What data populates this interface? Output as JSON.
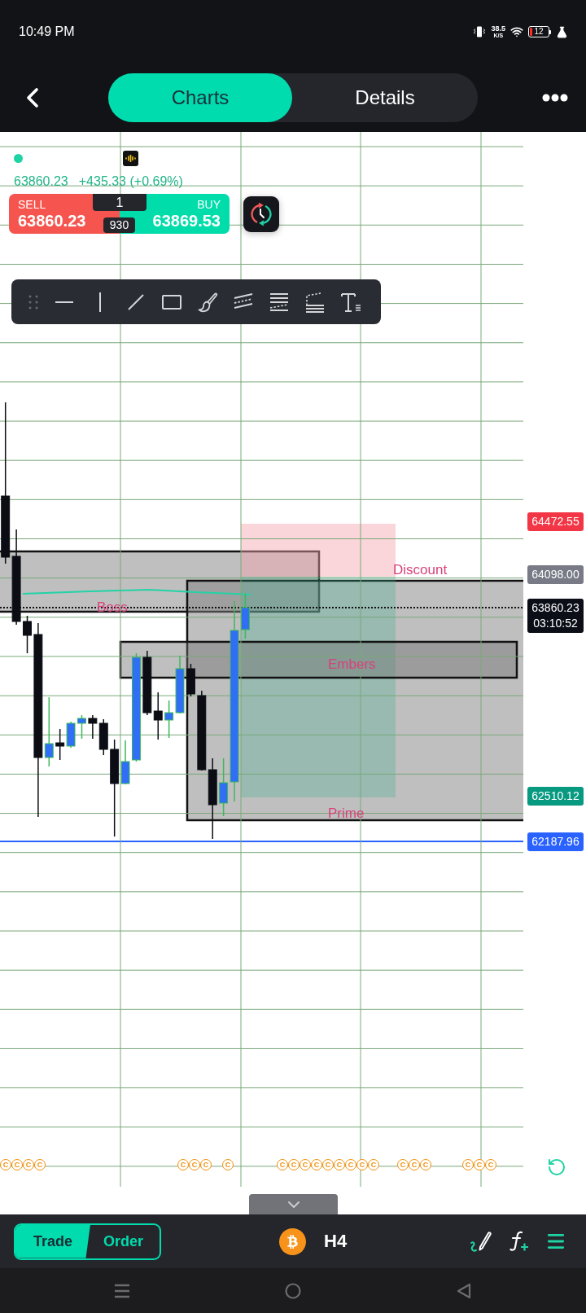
{
  "status_bar": {
    "time": "10:49 PM",
    "net_speed": "38.5",
    "net_speed_unit": "K/S",
    "battery": "12"
  },
  "header": {
    "tabs": [
      {
        "label": "Charts",
        "selected": true
      },
      {
        "label": "Details",
        "selected": false
      }
    ]
  },
  "quote": {
    "price": "63860.23",
    "change": "+435.33 (+0.69%)"
  },
  "trade_panel": {
    "sell": {
      "label": "SELL",
      "price": "63860.23"
    },
    "buy": {
      "label": "BUY",
      "price": "63869.53"
    },
    "lot_size": "1",
    "spread": "930"
  },
  "chart": {
    "chart_data": {
      "type": "candlestick",
      "categories": [
        null,
        null,
        null,
        null,
        null,
        null,
        null,
        null,
        null,
        null,
        null,
        null,
        null,
        null,
        null,
        null,
        null,
        null,
        null,
        null,
        null,
        null,
        null,
        null,
        null,
        null,
        null,
        null,
        null,
        null,
        null,
        null,
        null,
        null,
        null,
        null,
        null,
        null,
        null,
        null,
        null,
        null,
        null,
        null,
        null,
        null,
        null,
        null
      ],
      "ylim": [
        59717.1,
        67264
      ],
      "yticks": [
        {
          "value": 64472.55,
          "label": "64472.55"
        },
        {
          "value": 64098.0,
          "label": "64098.00"
        },
        {
          "value": 63860.23,
          "label": "63860.23"
        },
        {
          "value": 62510.12,
          "label": "62510.12"
        },
        {
          "value": 62187.96,
          "label": "62187.96"
        }
      ],
      "ohlc": [
        [
          64659.0,
          65329.2,
          64175.3,
          64221.9
        ],
        [
          64227.8,
          64420.1,
          63738.2,
          63761.6
        ],
        [
          63761.6,
          63802.4,
          63534.3,
          63662.5
        ],
        [
          63668.3,
          63749.9,
          62362.9,
          62788.3
        ],
        [
          62788.3,
          63219.6,
          62724.2,
          62887.4
        ],
        [
          62893.2,
          62992.3,
          62770.9,
          62869.9
        ],
        [
          62869.9,
          63044.8,
          62858.3,
          63033.1
        ],
        [
          63033.1,
          63091.4,
          62922.4,
          63068.1
        ],
        [
          63068.1,
          63091.4,
          62922.4,
          63033.1
        ],
        [
          63033.1,
          63062.2,
          62805.8,
          62846.6
        ],
        [
          62846.6,
          62916.5,
          62223.0,
          62601.8
        ],
        [
          62601.8,
          62910.7,
          62596.0,
          62759.2
        ],
        [
          62770.9,
          63534.3,
          62759.2,
          63505.1
        ],
        [
          63505.1,
          63551.8,
          63091.4,
          63108.9
        ],
        [
          63120.5,
          63254.5,
          62916.5,
          63056.4
        ],
        [
          63056.4,
          63196.3,
          62928.2,
          63108.9
        ],
        [
          63108.9,
          63516.8,
          63103.0,
          63423.6
        ],
        [
          63423.6,
          63458.5,
          63225.4,
          63242.9
        ],
        [
          63231.2,
          63266.2,
          62695.1,
          62700.9
        ],
        [
          62700.9,
          62782.5,
          62205.6,
          62450.3
        ],
        [
          62462.0,
          62782.5,
          62368.7,
          62607.7
        ],
        [
          62613.5,
          63907.3,
          62473.6,
          63697.5
        ],
        [
          63703.3,
          63959.7,
          63639.2,
          63860.2
        ],
        null,
        null,
        null,
        null,
        null,
        null,
        null,
        null,
        null,
        null,
        null,
        null,
        null,
        null,
        null,
        null,
        null,
        null,
        null,
        null,
        null,
        null,
        null,
        null,
        null
      ]
    },
    "price_tags": [
      {
        "color": "#f23645"
      },
      {
        "color": "#787b86"
      },
      {
        "color": "#0b0e17",
        "countdown": "03:10:52"
      },
      {
        "color": "#089981"
      },
      {
        "color": "#2962ff"
      }
    ],
    "zone_labels": [
      "Discount",
      "Boss",
      "Embers",
      "Prime"
    ],
    "event_markers": [
      [
        "C",
        "C",
        "C",
        "C"
      ],
      [
        "C",
        "C",
        "C"
      ],
      [
        "C"
      ],
      [
        "C",
        "C",
        "C",
        "C",
        "C",
        "C",
        "C",
        "C",
        "C"
      ],
      [
        "C",
        "C",
        "C"
      ],
      [
        "C",
        "C",
        "C"
      ]
    ]
  },
  "bottom_bar": {
    "mode_tabs": [
      {
        "label": "Trade",
        "selected": true
      },
      {
        "label": "Order",
        "selected": false
      }
    ],
    "timeframe": "H4"
  }
}
